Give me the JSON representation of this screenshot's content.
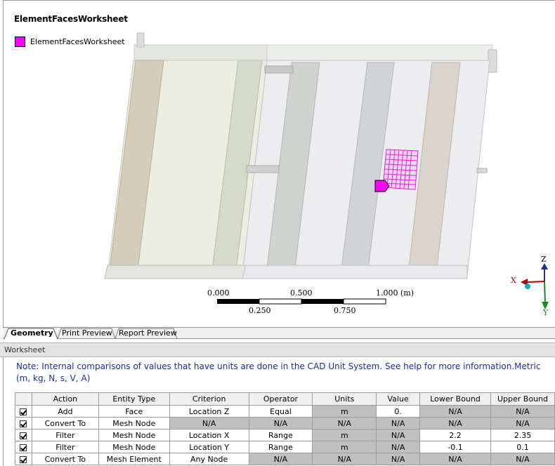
{
  "viewport": {
    "title": "ElementFacesWorksheet",
    "legend": {
      "label": "ElementFacesWorksheet",
      "color": "#ff00ff"
    },
    "scale": {
      "top_labels": [
        "0.000",
        "0.500",
        "1.000 (m)"
      ],
      "bottom_labels": [
        "0.250",
        "0.750"
      ]
    },
    "triad": {
      "x_label": "X",
      "y_label": "Y",
      "z_label": "Z"
    }
  },
  "tabs": [
    {
      "label": "Geometry",
      "active": true
    },
    {
      "label": "Print Preview",
      "active": false
    },
    {
      "label": "Report Preview",
      "active": false
    }
  ],
  "worksheet": {
    "title": "Worksheet",
    "note": "Note: Internal comparisons of values that have units are done in the CAD Unit System. See help for more information.Metric (m, kg, N, s, V, A)",
    "columns": [
      "",
      "Action",
      "Entity Type",
      "Criterion",
      "Operator",
      "Units",
      "Value",
      "Lower Bound",
      "Upper Bound"
    ],
    "rows": [
      {
        "checked": true,
        "action": "Add",
        "entity_type": "Face",
        "criterion": "Location Z",
        "operator": "Equal",
        "units": "m",
        "value": "0.",
        "lower": "N/A",
        "upper": "N/A"
      },
      {
        "checked": true,
        "action": "Convert To",
        "entity_type": "Mesh Node",
        "criterion": "N/A",
        "operator": "N/A",
        "units": "N/A",
        "value": "N/A",
        "lower": "N/A",
        "upper": "N/A"
      },
      {
        "checked": true,
        "action": "Filter",
        "entity_type": "Mesh Node",
        "criterion": "Location X",
        "operator": "Range",
        "units": "m",
        "value": "N/A",
        "lower": "2.2",
        "upper": "2.35"
      },
      {
        "checked": true,
        "action": "Filter",
        "entity_type": "Mesh Node",
        "criterion": "Location Y",
        "operator": "Range",
        "units": "m",
        "value": "N/A",
        "lower": "-0.1",
        "upper": "0.1"
      },
      {
        "checked": true,
        "action": "Convert To",
        "entity_type": "Mesh Element",
        "criterion": "Any Node",
        "operator": "N/A",
        "units": "N/A",
        "value": "N/A",
        "lower": "N/A",
        "upper": "N/A"
      }
    ]
  }
}
